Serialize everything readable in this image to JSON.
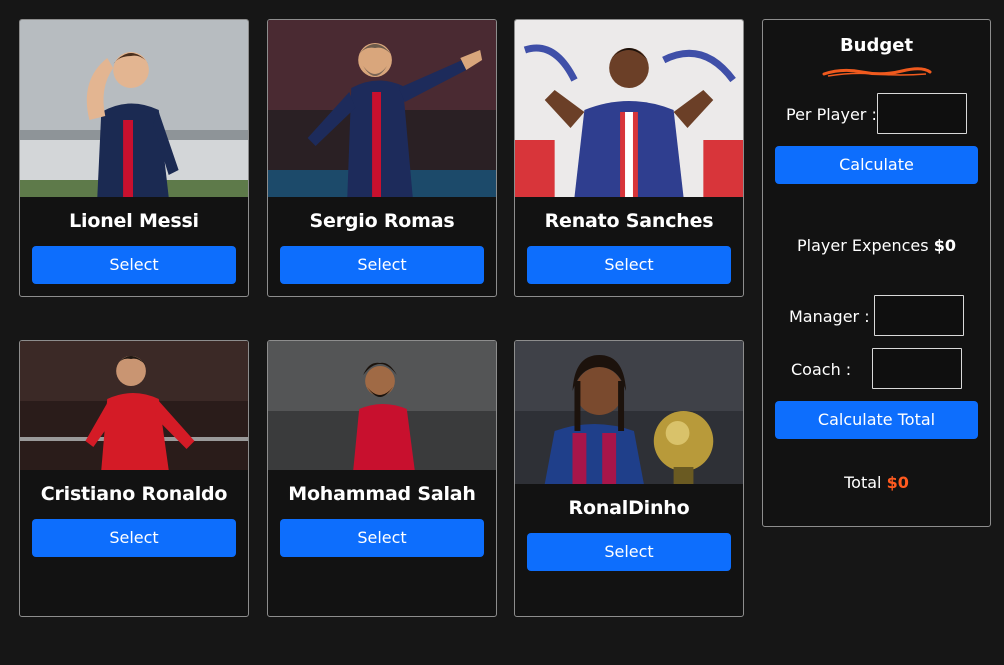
{
  "players": [
    {
      "name": "Lionel Messi",
      "select_label": "Select",
      "kit": "psg-navy",
      "skin": "#e3b591",
      "hair": "#4a2f1d"
    },
    {
      "name": "Sergio Romas",
      "select_label": "Select",
      "kit": "psg-navy",
      "skin": "#d9a67c",
      "hair": "#6b5a4a"
    },
    {
      "name": "Renato Sanches",
      "select_label": "Select",
      "kit": "psg-blue",
      "skin": "#6b3f27",
      "hair": "#1c120c"
    },
    {
      "name": "Cristiano Ronaldo",
      "select_label": "Select",
      "kit": "red",
      "skin": "#c99572",
      "hair": "#1f1712"
    },
    {
      "name": "Mohammad Salah",
      "select_label": "Select",
      "kit": "red",
      "skin": "#a06a45",
      "hair": "#1b130d"
    },
    {
      "name": "RonalDinho",
      "select_label": "Select",
      "kit": "barca",
      "skin": "#7a4a2e",
      "hair": "#1c120c"
    }
  ],
  "budget": {
    "title": "Budget",
    "per_player_label": "Per Player :",
    "per_player_value": "",
    "calculate_label": "Calculate",
    "player_expenses_label": "Player Expences",
    "player_expenses_value": "$0",
    "manager_label": "Manager :",
    "manager_value": "",
    "coach_label": "Coach :",
    "coach_value": "",
    "calculate_total_label": "Calculate Total",
    "total_label": "Total",
    "total_value": "$0"
  },
  "colors": {
    "accent": "#0d6efd",
    "total_highlight": "#ff5a1f",
    "squiggle": "#f05a1e",
    "background": "#161616"
  }
}
